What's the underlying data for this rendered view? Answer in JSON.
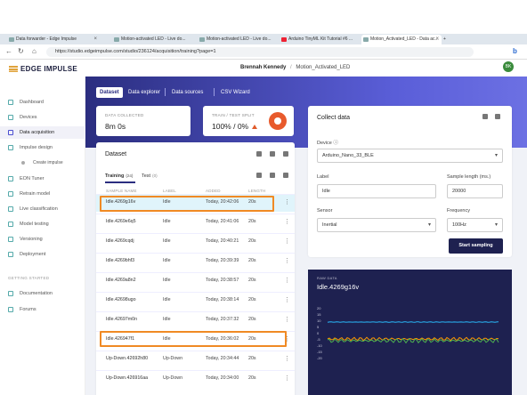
{
  "browser": {
    "tabs": [
      {
        "label": "Data forwarder - Edge Impulse"
      },
      {
        "label": "Motion-activated LED - Live do..."
      },
      {
        "label": "Motion-activated LED - Live do..."
      },
      {
        "label": "Arduino TinyML Kit Tutorial #6 ..."
      },
      {
        "label": "Motion_Activated_LED - Data ac..."
      }
    ],
    "url": "https://studio.edgeimpulse.com/studio/236124/acquisition/training?page=1"
  },
  "header": {
    "logo": "EDGE IMPULSE",
    "user": "Brennah Kennedy",
    "separator": "/",
    "project": "Motion_Activated_LED",
    "avatar": "BK"
  },
  "sidebar": {
    "items": [
      {
        "label": "Dashboard",
        "icon": "dashboard-icon"
      },
      {
        "label": "Devices",
        "icon": "devices-icon"
      },
      {
        "label": "Data acquisition",
        "icon": "data-acquisition-icon"
      },
      {
        "label": "Impulse design",
        "icon": "impulse-icon"
      },
      {
        "label": "Create impulse",
        "icon": "dot-icon"
      },
      {
        "label": "EON Tuner",
        "icon": "tuner-icon"
      },
      {
        "label": "Retrain model",
        "icon": "retrain-icon"
      },
      {
        "label": "Live classification",
        "icon": "live-icon"
      },
      {
        "label": "Model testing",
        "icon": "testing-icon"
      },
      {
        "label": "Versioning",
        "icon": "versioning-icon"
      },
      {
        "label": "Deployment",
        "icon": "deployment-icon"
      }
    ],
    "section_getting_started": "GETTING STARTED",
    "getting_started": [
      {
        "label": "Documentation",
        "icon": "documentation-icon"
      },
      {
        "label": "Forums",
        "icon": "forums-icon"
      }
    ]
  },
  "main_tabs": [
    "Dataset",
    "Data explorer",
    "Data sources",
    "CSV Wizard"
  ],
  "stats": {
    "collected_label": "DATA COLLECTED",
    "collected_value": "8m 0s",
    "split_label": "TRAIN / TEST SPLIT",
    "split_value": "100% / 0%"
  },
  "dataset": {
    "title": "Dataset",
    "training_tab": "Training",
    "training_count": "(24)",
    "test_tab": "Test",
    "test_count": "(0)",
    "columns": [
      "SAMPLE NAME",
      "LABEL",
      "ADDED",
      "LENGTH"
    ],
    "rows": [
      {
        "name": "Idle.4269g16v",
        "label": "Idle",
        "added": "Today, 20:42:06",
        "length": "20s"
      },
      {
        "name": "Idle.4269e6q5",
        "label": "Idle",
        "added": "Today, 20:41:06",
        "length": "20s"
      },
      {
        "name": "Idle.4269cqdj",
        "label": "Idle",
        "added": "Today, 20:40:21",
        "length": "20s"
      },
      {
        "name": "Idle.4269bhf3",
        "label": "Idle",
        "added": "Today, 20:39:39",
        "length": "20s"
      },
      {
        "name": "Idle.4269a8n2",
        "label": "Idle",
        "added": "Today, 20:38:57",
        "length": "20s"
      },
      {
        "name": "Idle.42698ugo",
        "label": "Idle",
        "added": "Today, 20:38:14",
        "length": "20s"
      },
      {
        "name": "Idle.42697m0n",
        "label": "Idle",
        "added": "Today, 20:37:32",
        "length": "20s"
      },
      {
        "name": "Idle.426947f1",
        "label": "Idle",
        "added": "Today, 20:36:02",
        "length": "20s"
      },
      {
        "name": "Up-Down.42692h80",
        "label": "Up-Down",
        "added": "Today, 20:34:44",
        "length": "20s"
      },
      {
        "name": "Up-Down.426916aa",
        "label": "Up-Down",
        "added": "Today, 20:34:00",
        "length": "20s"
      }
    ]
  },
  "collect": {
    "title": "Collect data",
    "device_label": "Device",
    "device_value": "Arduino_Nano_33_BLE",
    "label_label": "Label",
    "label_value": "Idle",
    "length_label": "Sample length (ms.)",
    "length_value": "20000",
    "sensor_label": "Sensor",
    "sensor_value": "Inertial",
    "freq_label": "Frequency",
    "freq_value": "100Hz",
    "start_button": "Start sampling"
  },
  "raw": {
    "section_label": "RAW DATA",
    "sample_name": "Idle.4269g16v",
    "yticks": [
      "20",
      "15",
      "10",
      "5",
      "0",
      "-5",
      "-10",
      "-15",
      "-20"
    ]
  },
  "colors": {
    "accent": "#2b2e80",
    "highlight": "#f08a24",
    "selected_row": "#e0f4fb",
    "raw_bg": "#1e2150",
    "series": [
      "#29b6f6",
      "#ff9800",
      "#4caf50"
    ]
  }
}
